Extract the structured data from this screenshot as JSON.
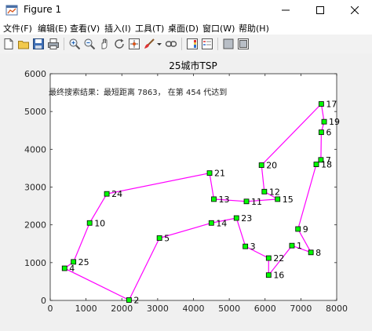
{
  "window": {
    "title": "Figure 1",
    "icon": "matlab-figure-icon",
    "controls": [
      "minimize-icon",
      "maximize-icon",
      "close-icon"
    ]
  },
  "menu": {
    "items": [
      "文件(F)",
      "编辑(E)",
      "查看(V)",
      "插入(I)",
      "工具(T)",
      "桌面(D)",
      "窗口(W)",
      "帮助(H)"
    ]
  },
  "toolbar": {
    "icons": [
      "new-figure-icon",
      "open-file-icon",
      "save-icon",
      "print-icon",
      "zoom-in-icon",
      "zoom-out-icon",
      "pan-icon",
      "rotate-3d-icon",
      "data-cursor-icon",
      "brush-icon",
      "brush-dropdown-icon",
      "link-plot-icon",
      "insert-colorbar-icon",
      "insert-legend-icon",
      "hide-plot-tools-icon",
      "show-plot-tools-icon"
    ]
  },
  "chart_data": {
    "type": "line",
    "title": "25城市TSP",
    "annotation": "最终搜索结果：最短距离 7863， 在第 454 代达到",
    "xlabel": "",
    "ylabel": "",
    "xlim": [
      0,
      8000
    ],
    "ylim": [
      0,
      6000
    ],
    "xticks": [
      0,
      1000,
      2000,
      3000,
      4000,
      5000,
      6000,
      7000,
      8000
    ],
    "yticks": [
      0,
      1000,
      2000,
      3000,
      4000,
      5000,
      6000
    ],
    "grid": false,
    "line_color": "#ff00ff",
    "marker_color": "#00ff00",
    "cities": [
      {
        "label": "1",
        "x": 6750,
        "y": 1450
      },
      {
        "label": "2",
        "x": 2200,
        "y": 10
      },
      {
        "label": "3",
        "x": 5450,
        "y": 1430
      },
      {
        "label": "4",
        "x": 400,
        "y": 850
      },
      {
        "label": "5",
        "x": 3050,
        "y": 1650
      },
      {
        "label": "6",
        "x": 7570,
        "y": 4450
      },
      {
        "label": "7",
        "x": 7560,
        "y": 3720
      },
      {
        "label": "8",
        "x": 7280,
        "y": 1270
      },
      {
        "label": "9",
        "x": 6920,
        "y": 1890
      },
      {
        "label": "10",
        "x": 1100,
        "y": 2050
      },
      {
        "label": "11",
        "x": 5480,
        "y": 2620
      },
      {
        "label": "12",
        "x": 5980,
        "y": 2880
      },
      {
        "label": "13",
        "x": 4570,
        "y": 2680
      },
      {
        "label": "14",
        "x": 4500,
        "y": 2050
      },
      {
        "label": "15",
        "x": 6350,
        "y": 2680
      },
      {
        "label": "16",
        "x": 6100,
        "y": 670
      },
      {
        "label": "17",
        "x": 7570,
        "y": 5200
      },
      {
        "label": "18",
        "x": 7430,
        "y": 3600
      },
      {
        "label": "19",
        "x": 7650,
        "y": 4730
      },
      {
        "label": "20",
        "x": 5900,
        "y": 3580
      },
      {
        "label": "21",
        "x": 4450,
        "y": 3370
      },
      {
        "label": "22",
        "x": 6100,
        "y": 1120
      },
      {
        "label": "23",
        "x": 5200,
        "y": 2180
      },
      {
        "label": "24",
        "x": 1580,
        "y": 2820
      },
      {
        "label": "25",
        "x": 650,
        "y": 1020
      }
    ],
    "route": [
      "2",
      "5",
      "14",
      "23",
      "3",
      "22",
      "16",
      "1",
      "8",
      "9",
      "18",
      "7",
      "6",
      "19",
      "17",
      "20",
      "12",
      "15",
      "11",
      "13",
      "21",
      "24",
      "10",
      "25",
      "4",
      "2"
    ]
  }
}
